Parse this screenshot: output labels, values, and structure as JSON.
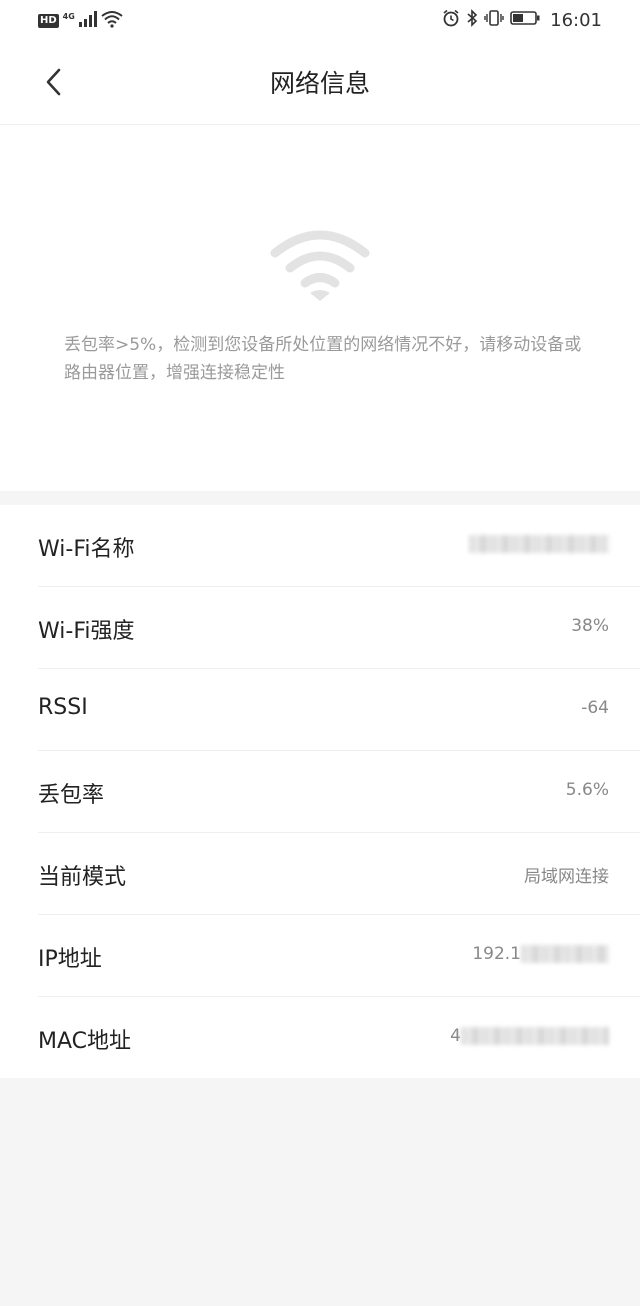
{
  "status_bar": {
    "hd_label": "HD",
    "network_type": "4G",
    "time": "16:01"
  },
  "header": {
    "title": "网络信息",
    "back_icon": "chevron-left-icon"
  },
  "banner": {
    "icon": "wifi-icon",
    "message": "丢包率>5%，检测到您设备所处位置的网络情况不好，请移动设备或路由器位置，增强连接稳定性"
  },
  "info_rows": [
    {
      "label": "Wi-Fi名称",
      "value": ""
    },
    {
      "label": "Wi-Fi强度",
      "value": "38%"
    },
    {
      "label": "RSSI",
      "value": "-64"
    },
    {
      "label": "丢包率",
      "value": "5.6%"
    },
    {
      "label": "当前模式",
      "value": "局域网连接"
    },
    {
      "label": "IP地址",
      "value": "192.1"
    },
    {
      "label": "MAC地址",
      "value": "4"
    }
  ],
  "colors": {
    "background": "#f5f5f5",
    "card": "#ffffff",
    "primary_text": "#222222",
    "secondary_text": "#888888",
    "hint_text": "#9a9a9a",
    "icon_gray": "#e0e0e0"
  }
}
